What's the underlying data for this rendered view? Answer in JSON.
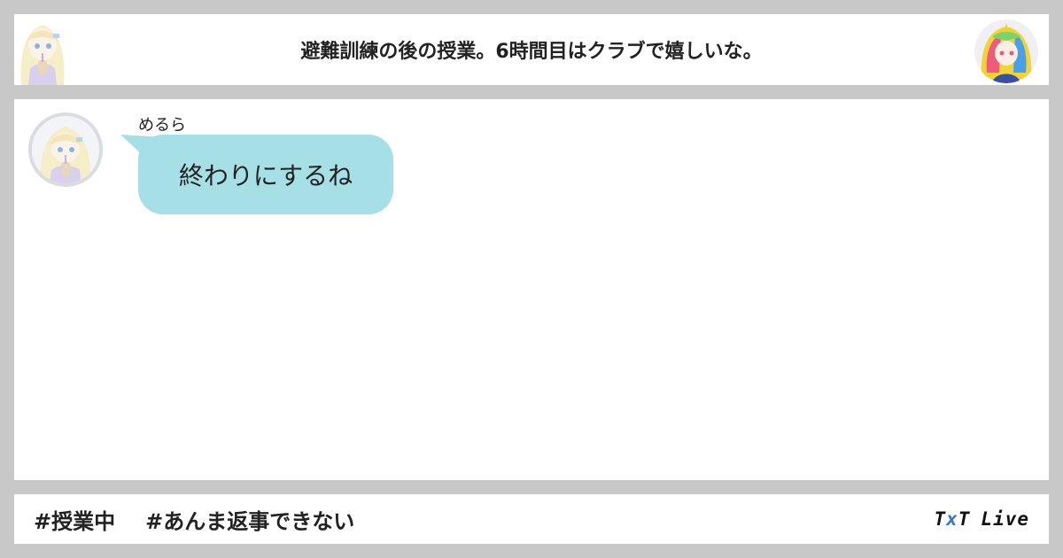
{
  "header": {
    "title": "避難訓練の後の授業。6時間目はクラブで嬉しいな。"
  },
  "message": {
    "sender": "めるら",
    "text": "終わりにするね"
  },
  "footer": {
    "tags": [
      "#授業中",
      "#あんま返事できない"
    ],
    "brand": {
      "part1": "T",
      "part2": "x",
      "part3": "T",
      "part4": "Live"
    }
  },
  "colors": {
    "background": "#c8c8c8",
    "bubble": "#a6dfe6",
    "brand_x": "#3a76c4"
  }
}
